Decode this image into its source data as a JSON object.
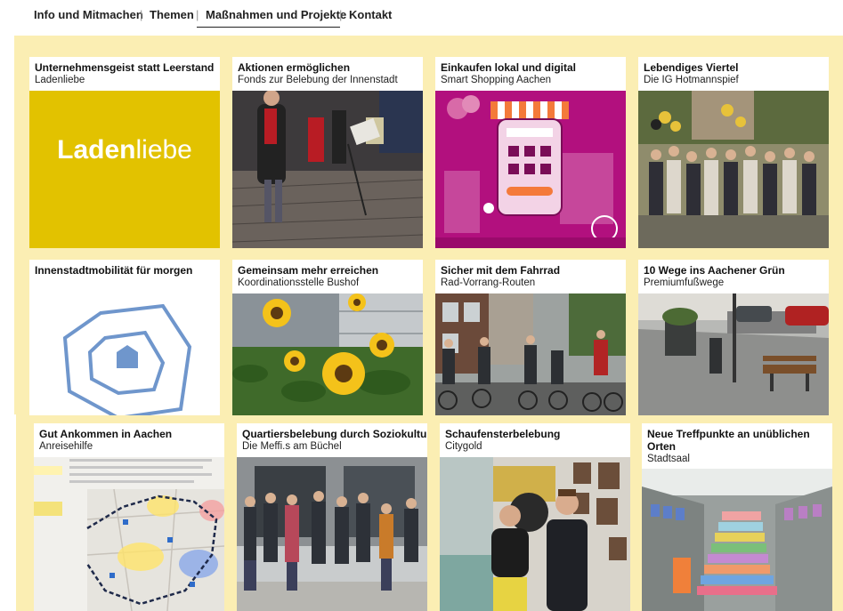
{
  "nav": {
    "items": [
      "Info und Mitmachen",
      "Themen",
      "Maßnahmen und Projekte",
      "Kontakt"
    ],
    "separator": "|"
  },
  "colors": {
    "band": "#fbeeb3",
    "ladenliebe_yellow": "#e2c200",
    "smartshopping_magenta": "#b2107e",
    "map_blue": "#6f96cc"
  },
  "cards": [
    {
      "title": "Unternehmensgeist statt Leerstand",
      "subtitle": "Ladenliebe",
      "image": "ladenliebe-logo",
      "logo_bold": "Laden",
      "logo_light": "liebe"
    },
    {
      "title": "Aktionen ermöglichen",
      "subtitle": "Fonds zur Belebung der Innenstadt",
      "image": "street-musicians-photo"
    },
    {
      "title": "Einkaufen lokal und digital",
      "subtitle": "Smart Shopping Aachen",
      "image": "smart-shopping-illustration"
    },
    {
      "title": "Lebendiges Viertel",
      "subtitle": "Die IG Hotmannspief",
      "image": "group-photo"
    },
    {
      "title": "Innenstadtmobilität für morgen",
      "subtitle": "",
      "image": "city-ring-map-icon"
    },
    {
      "title": "Gemeinsam mehr erreichen",
      "subtitle": "Koordinationsstelle Bushof",
      "image": "sunflowers-photo"
    },
    {
      "title": "Sicher mit dem Fahrrad",
      "subtitle": "Rad-Vorrang-Routen",
      "image": "cyclists-photo"
    },
    {
      "title": "10 Wege ins Aachener Grün",
      "subtitle": "Premiumfußwege",
      "image": "street-bench-photo"
    },
    {
      "title": "Gut Ankommen in Aachen",
      "subtitle": "Anreisehilfe",
      "image": "parking-map"
    },
    {
      "title": "Quartiersbelebung durch Soziokultur",
      "subtitle": "Die Meffi.s am Büchel",
      "image": "group-in-front-of-building-photo"
    },
    {
      "title": "Schaufensterbelebung",
      "subtitle": "Citygold",
      "image": "shop-window-photo"
    },
    {
      "title": "Neue Treffpunkte an unüblichen Orten",
      "subtitle": "Stadtsaal",
      "image": "colorful-stairs-photo"
    }
  ]
}
